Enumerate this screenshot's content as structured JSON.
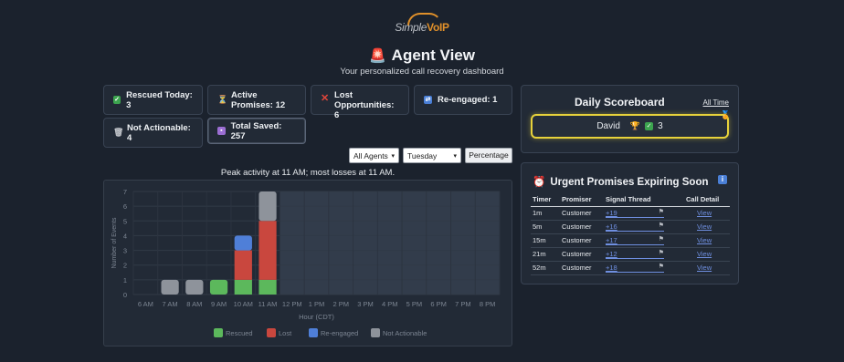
{
  "logo": {
    "part1": "Simple",
    "part2": "VoIP"
  },
  "header": {
    "title": "Agent View",
    "subtitle": "Your personalized call recovery dashboard"
  },
  "stats": {
    "rescued": "Rescued Today: 3",
    "active": "Active Promises: 12",
    "lost_line1": "Lost Opportunities:",
    "lost_line2": "6",
    "reengaged": "Re-engaged: 1",
    "not_actionable": "Not Actionable: 4",
    "total_saved": "Total Saved: 257"
  },
  "filters": {
    "agent_selected": "All Agents",
    "day_selected": "Tuesday",
    "percentage_label": "Percentage"
  },
  "peak_text": "Peak activity at 11 AM; most losses at 11 AM.",
  "chart_data": {
    "type": "bar",
    "stacked": true,
    "categories": [
      "6 AM",
      "7 AM",
      "8 AM",
      "9 AM",
      "10 AM",
      "11 AM",
      "12 PM",
      "1 PM",
      "2 PM",
      "3 PM",
      "4 PM",
      "5 PM",
      "6 PM",
      "7 PM",
      "8 PM"
    ],
    "series": [
      {
        "name": "Rescued",
        "values": [
          0,
          0,
          0,
          1,
          1,
          1,
          0,
          0,
          0,
          0,
          0,
          0,
          0,
          0,
          0
        ],
        "color": "#5cb85c"
      },
      {
        "name": "Lost",
        "values": [
          0,
          0,
          0,
          0,
          2,
          4,
          0,
          0,
          0,
          0,
          0,
          0,
          0,
          0,
          0
        ],
        "color": "#c9473e"
      },
      {
        "name": "Re-engaged",
        "values": [
          0,
          0,
          0,
          0,
          1,
          0,
          0,
          0,
          0,
          0,
          0,
          0,
          0,
          0,
          0
        ],
        "color": "#4f7fd8"
      },
      {
        "name": "Not Actionable",
        "values": [
          0,
          1,
          1,
          0,
          0,
          2,
          0,
          0,
          0,
          0,
          0,
          0,
          0,
          0,
          0
        ],
        "color": "#8e939b"
      }
    ],
    "xlabel": "Hour (CDT)",
    "ylabel": "Number of Events",
    "ylim": [
      0,
      7
    ],
    "yticks": [
      "0",
      "1",
      "2",
      "3",
      "4",
      "5",
      "6",
      "7"
    ],
    "shaded_future_from": "12 PM",
    "legend": "bottom"
  },
  "scoreboard": {
    "title": "Daily Scoreboard",
    "all_time": "All Time",
    "agent": "David",
    "count": "3"
  },
  "urgent": {
    "title": "Urgent Promises Expiring Soon",
    "columns": [
      "Timer",
      "Promiser",
      "Signal Thread",
      "Call Detail"
    ],
    "rows": [
      {
        "timer": "1m",
        "promiser": "Customer",
        "thread": "+19",
        "detail": "View"
      },
      {
        "timer": "5m",
        "promiser": "Customer",
        "thread": "+16",
        "detail": "View"
      },
      {
        "timer": "15m",
        "promiser": "Customer",
        "thread": "+17",
        "detail": "View"
      },
      {
        "timer": "21m",
        "promiser": "Customer",
        "thread": "+12",
        "detail": "View"
      },
      {
        "timer": "52m",
        "promiser": "Customer",
        "thread": "+18",
        "detail": "View"
      }
    ]
  }
}
